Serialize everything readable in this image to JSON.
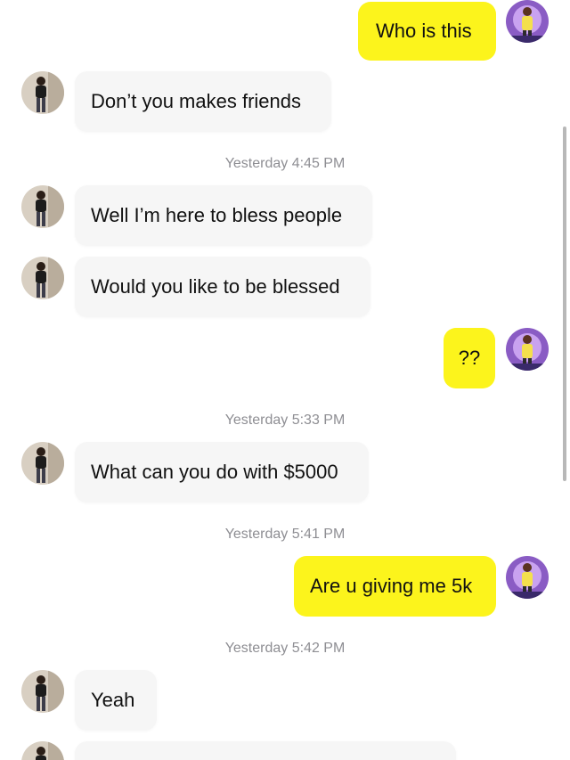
{
  "messages": [
    {
      "side": "out",
      "text": "Who is this"
    },
    {
      "side": "in",
      "text": "Don’t you makes friends"
    },
    {
      "type": "timestamp",
      "text": "Yesterday 4:45 PM"
    },
    {
      "side": "in",
      "text": "Well I’m here to bless people"
    },
    {
      "side": "in",
      "text": "Would you like to be blessed"
    },
    {
      "side": "out",
      "text": "??"
    },
    {
      "type": "timestamp",
      "text": "Yesterday 5:33 PM"
    },
    {
      "side": "in",
      "text": "What can you do with $5000"
    },
    {
      "type": "timestamp",
      "text": "Yesterday 5:41 PM"
    },
    {
      "side": "out",
      "text": "Are u giving me 5k"
    },
    {
      "type": "timestamp",
      "text": "Yesterday 5:42 PM"
    },
    {
      "side": "in",
      "text": "Yeah"
    }
  ],
  "colors": {
    "outgoing_bubble": "#fcf41c",
    "incoming_bubble": "#f6f6f6",
    "timestamp_text": "#8e8e93"
  }
}
